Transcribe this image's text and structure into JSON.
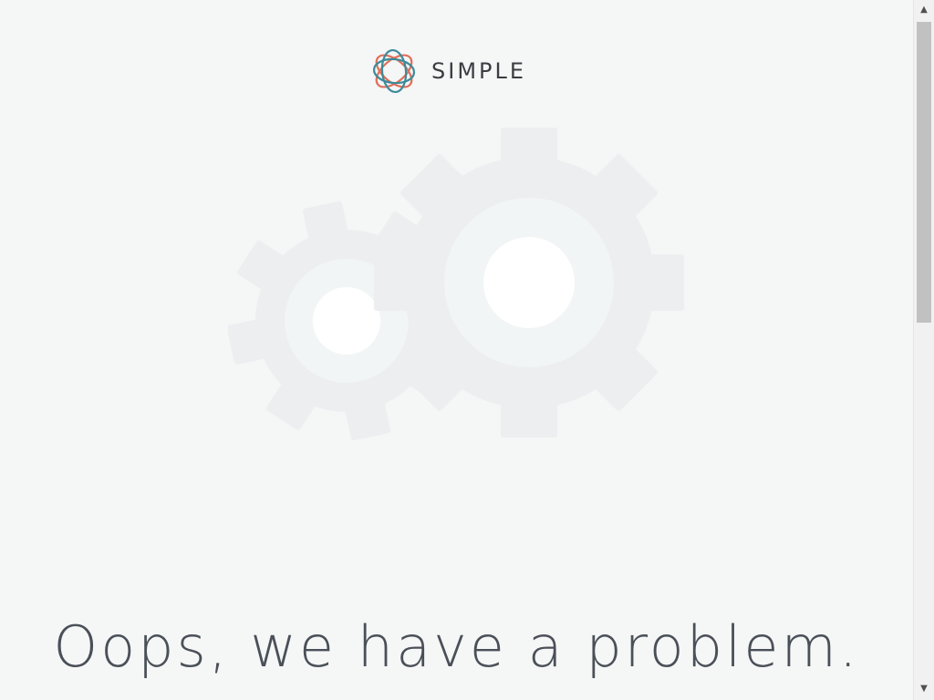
{
  "brand": {
    "name": "SIMPLE",
    "colors": {
      "teal": "#3d8a99",
      "coral": "#e06f5a"
    }
  },
  "illustration": {
    "icon": "gears-icon",
    "colors": {
      "gear": "#eceef0",
      "ring": "#f2f5f6",
      "hub": "#ffffff"
    }
  },
  "error": {
    "headline": "Oops, we have a problem."
  },
  "scrollbar": {
    "up_glyph": "▲",
    "down_glyph": "▼"
  }
}
